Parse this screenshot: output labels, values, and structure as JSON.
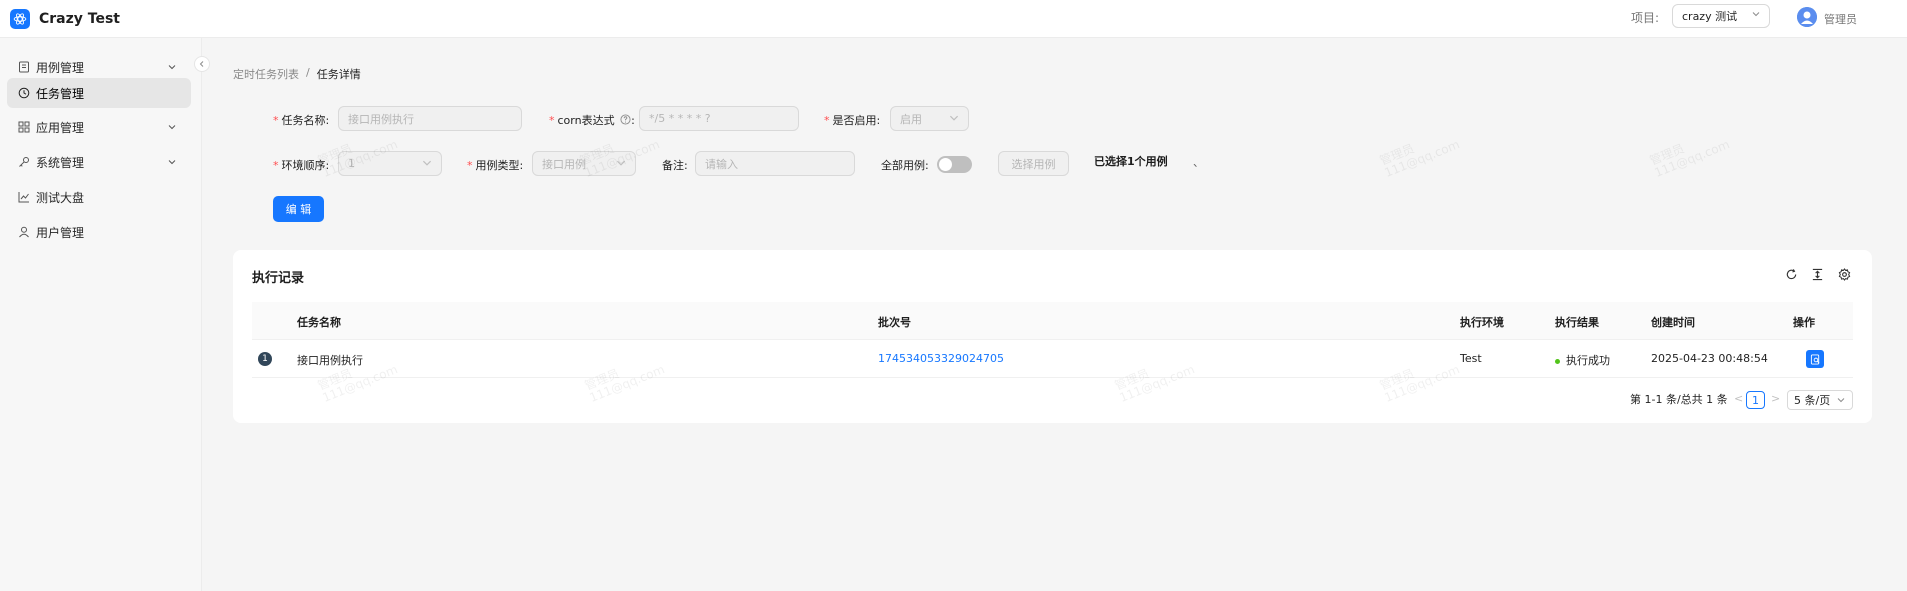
{
  "header": {
    "app_title": "Crazy Test",
    "project_label": "项目:",
    "project_value": "crazy 测试",
    "user_name": "管理员"
  },
  "sidebar": {
    "items": [
      {
        "label": "用例管理",
        "icon": "file-icon",
        "expandable": true,
        "active": false
      },
      {
        "label": "任务管理",
        "icon": "clock-icon",
        "expandable": false,
        "active": true
      },
      {
        "label": "应用管理",
        "icon": "grid-icon",
        "expandable": true,
        "active": false
      },
      {
        "label": "系统管理",
        "icon": "key-icon",
        "expandable": true,
        "active": false
      },
      {
        "label": "测试大盘",
        "icon": "line-chart-icon",
        "expandable": false,
        "active": false
      },
      {
        "label": "用户管理",
        "icon": "user-icon",
        "expandable": false,
        "active": false
      }
    ]
  },
  "breadcrumb": {
    "parent": "定时任务列表",
    "separator": "/",
    "current": "任务详情"
  },
  "form": {
    "task_name_label": "任务名称:",
    "task_name_placeholder": "接口用例执行",
    "cron_label": "corn表达式",
    "cron_suffix": ":",
    "cron_placeholder": "*/5 * * * * ?",
    "enabled_label": "是否启用:",
    "enabled_value": "启用",
    "env_order_label": "环境顺序:",
    "env_order_value": "1",
    "case_type_label": "用例类型:",
    "case_type_value": "接口用例",
    "remark_label": "备注:",
    "remark_placeholder": "请输入",
    "all_cases_label": "全部用例:",
    "all_cases_on": false,
    "select_cases_button": "选择用例",
    "selected_info": "已选择1个用例",
    "separator_mark": "、",
    "edit_button": "编 辑"
  },
  "records": {
    "title": "执行记录",
    "columns": [
      "任务名称",
      "批次号",
      "执行环境",
      "执行结果",
      "创建时间",
      "操作"
    ],
    "rows": [
      {
        "index": "1",
        "task_name": "接口用例执行",
        "batch_no": "174534053329024705",
        "env": "Test",
        "result": "执行成功",
        "created_at": "2025-04-23 00:48:54"
      }
    ],
    "pagination": {
      "summary": "第 1-1 条/总共 1 条",
      "current_page": "1",
      "page_size": "5 条/页",
      "prev": "<",
      "next": ">"
    }
  },
  "watermark": {
    "text_line1": "管理员",
    "text_line2": "111@qq.com"
  },
  "colors": {
    "primary": "#1677ff",
    "success": "#52c41a",
    "required": "#ff4d4f"
  }
}
